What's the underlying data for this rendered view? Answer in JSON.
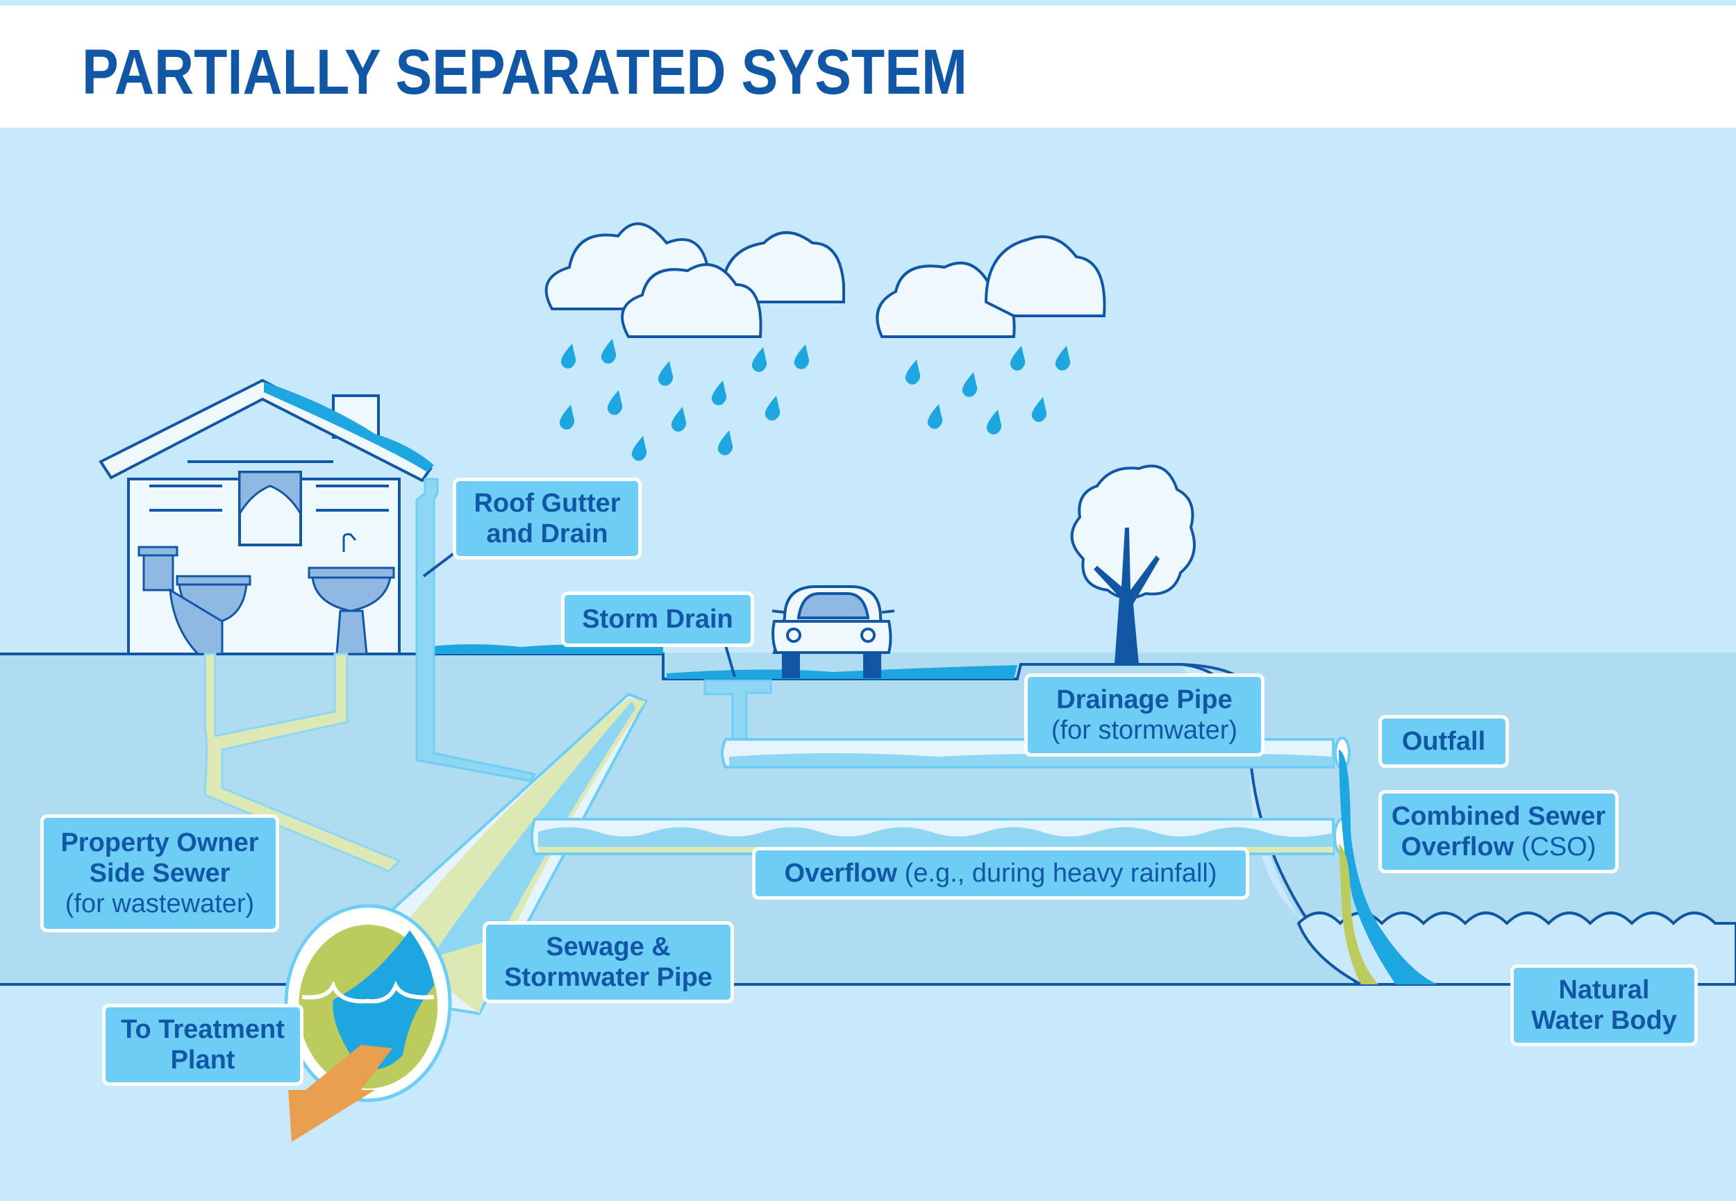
{
  "title": "PARTIALLY SEPARATED SYSTEM",
  "colors": {
    "sky": "#c8e9fb",
    "underground": "#b0dcf2",
    "deep": "#c8e9fb",
    "outline": "#1257a6",
    "water": "#1ea6e0",
    "label_bg": "#6dcdf4",
    "sewage": "#bccb5e",
    "arrow": "#e8a050"
  },
  "labels": {
    "roof_gutter": {
      "line1": "Roof Gutter",
      "line2": "and Drain"
    },
    "storm_drain": {
      "line1": "Storm Drain"
    },
    "drainage_pipe": {
      "line1": "Drainage Pipe",
      "line2": "(for stormwater)"
    },
    "outfall": {
      "line1": "Outfall"
    },
    "cso": {
      "line1": "Combined Sewer",
      "line2_bold": "Overflow",
      "line2_normal": " (CSO)"
    },
    "overflow": {
      "bold": "Overflow",
      "normal": " (e.g., during heavy rainfall)"
    },
    "property_owner": {
      "line1": "Property Owner",
      "line2": "Side Sewer",
      "line3": "(for wastewater)"
    },
    "sewage_pipe": {
      "line1": "Sewage &",
      "line2": "Stormwater Pipe"
    },
    "treatment": {
      "line1": "To Treatment",
      "line2": "Plant"
    },
    "water_body": {
      "line1": "Natural",
      "line2": "Water Body"
    }
  },
  "icons": [
    "cloud-icon",
    "raindrop-icon",
    "house-icon",
    "toilet-icon",
    "sink-icon",
    "car-icon",
    "tree-icon",
    "arrow-icon"
  ]
}
